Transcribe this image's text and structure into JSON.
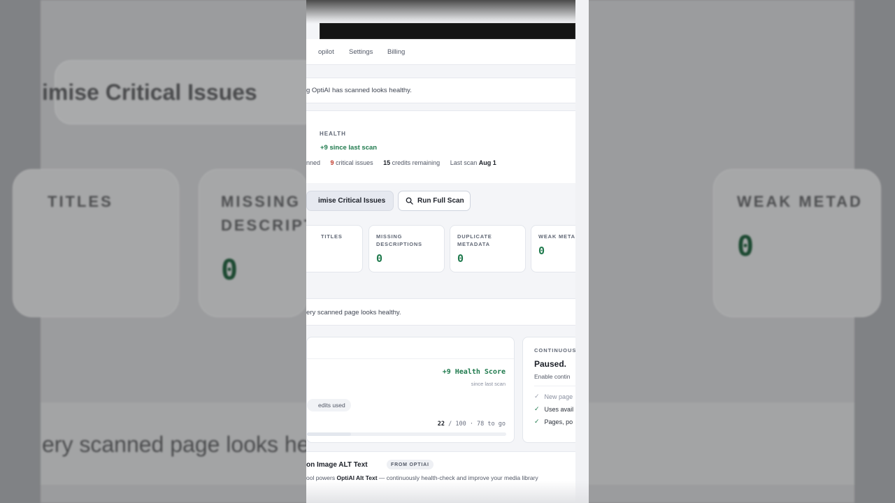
{
  "backdrop": {
    "optimise_label": "imise Critical Issues",
    "card_labels": [
      "TITLES",
      "MISSING",
      "DESCRIPT",
      "WEAK METAD"
    ],
    "card_zero_a": "0",
    "card_zero_b": "0",
    "healthy_text": "ery scanned page looks he"
  },
  "nav": {
    "items": [
      "opilot",
      "Settings",
      "Billing"
    ]
  },
  "banner_top": {
    "text": "g OptiAI has scanned looks healthy."
  },
  "health": {
    "kicker": "HEALTH",
    "delta": "+9 since last scan",
    "scanned_label": "nned",
    "critical_count": "9",
    "critical_label": "critical issues",
    "credits_count": "15",
    "credits_label": "credits remaining",
    "last_scan_label": "Last scan",
    "last_scan_value": "Aug 1"
  },
  "actions": {
    "optimise_label": "imise Critical Issues",
    "scan_label": "Run Full Scan"
  },
  "metrics": [
    {
      "label_line1": "TITLES",
      "label_line2": "",
      "value": ""
    },
    {
      "label_line1": "MISSING",
      "label_line2": "DESCRIPTIONS",
      "value": "0"
    },
    {
      "label_line1": "DUPLICATE",
      "label_line2": "METADATA",
      "value": "0"
    },
    {
      "label_line1": "WEAK METAD",
      "label_line2": "",
      "value": "0"
    }
  ],
  "healthy_banner": {
    "text": "ery scanned page looks healthy."
  },
  "score": {
    "value": "+9 Health Score",
    "since": "since last scan",
    "credits_used_label": "edits used",
    "progress_current": "22",
    "progress_text": " / 100 · 78 to go",
    "progress_fraction": 0.22
  },
  "continuous": {
    "kicker": "CONTINUOUS",
    "title": "Paused.",
    "subtitle": "Enable contin",
    "items": [
      {
        "label": "New page",
        "muted": true
      },
      {
        "label": "Uses avail",
        "muted": false
      },
      {
        "label": "Pages, po",
        "muted": false
      }
    ]
  },
  "alt_text": {
    "title": "on Image ALT Text",
    "badge": "FROM OPTIAI",
    "desc_prefix": "ool powers ",
    "desc_bold": "OptiAI Alt Text",
    "desc_suffix": " — continuously health-check and improve your media library"
  },
  "colors": {
    "accent_green": "#1f7a4d",
    "critical_red": "#c0392b",
    "panel_bg": "#f4f5f8"
  }
}
